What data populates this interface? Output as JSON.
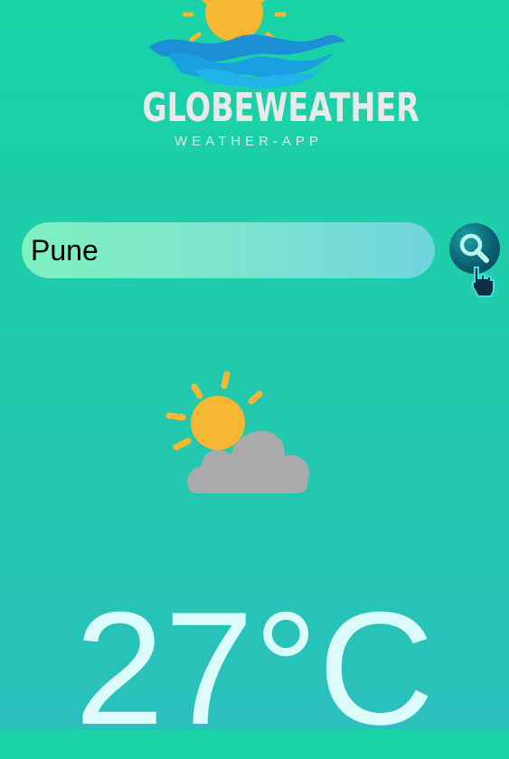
{
  "logo": {
    "title": "GLOBEWEATHER",
    "subtitle": "WEATHER-APP"
  },
  "search": {
    "value": "Pune",
    "button_icon": "search-icon"
  },
  "weather": {
    "icon": "partly-cloudy-icon",
    "temperature": "27°C"
  },
  "colors": {
    "background_top": "#19d3a6",
    "background_bottom": "#2bc0bd",
    "search_button": "#0c5f73",
    "sun": "#f7b733",
    "cloud": "#a9a9a9"
  }
}
